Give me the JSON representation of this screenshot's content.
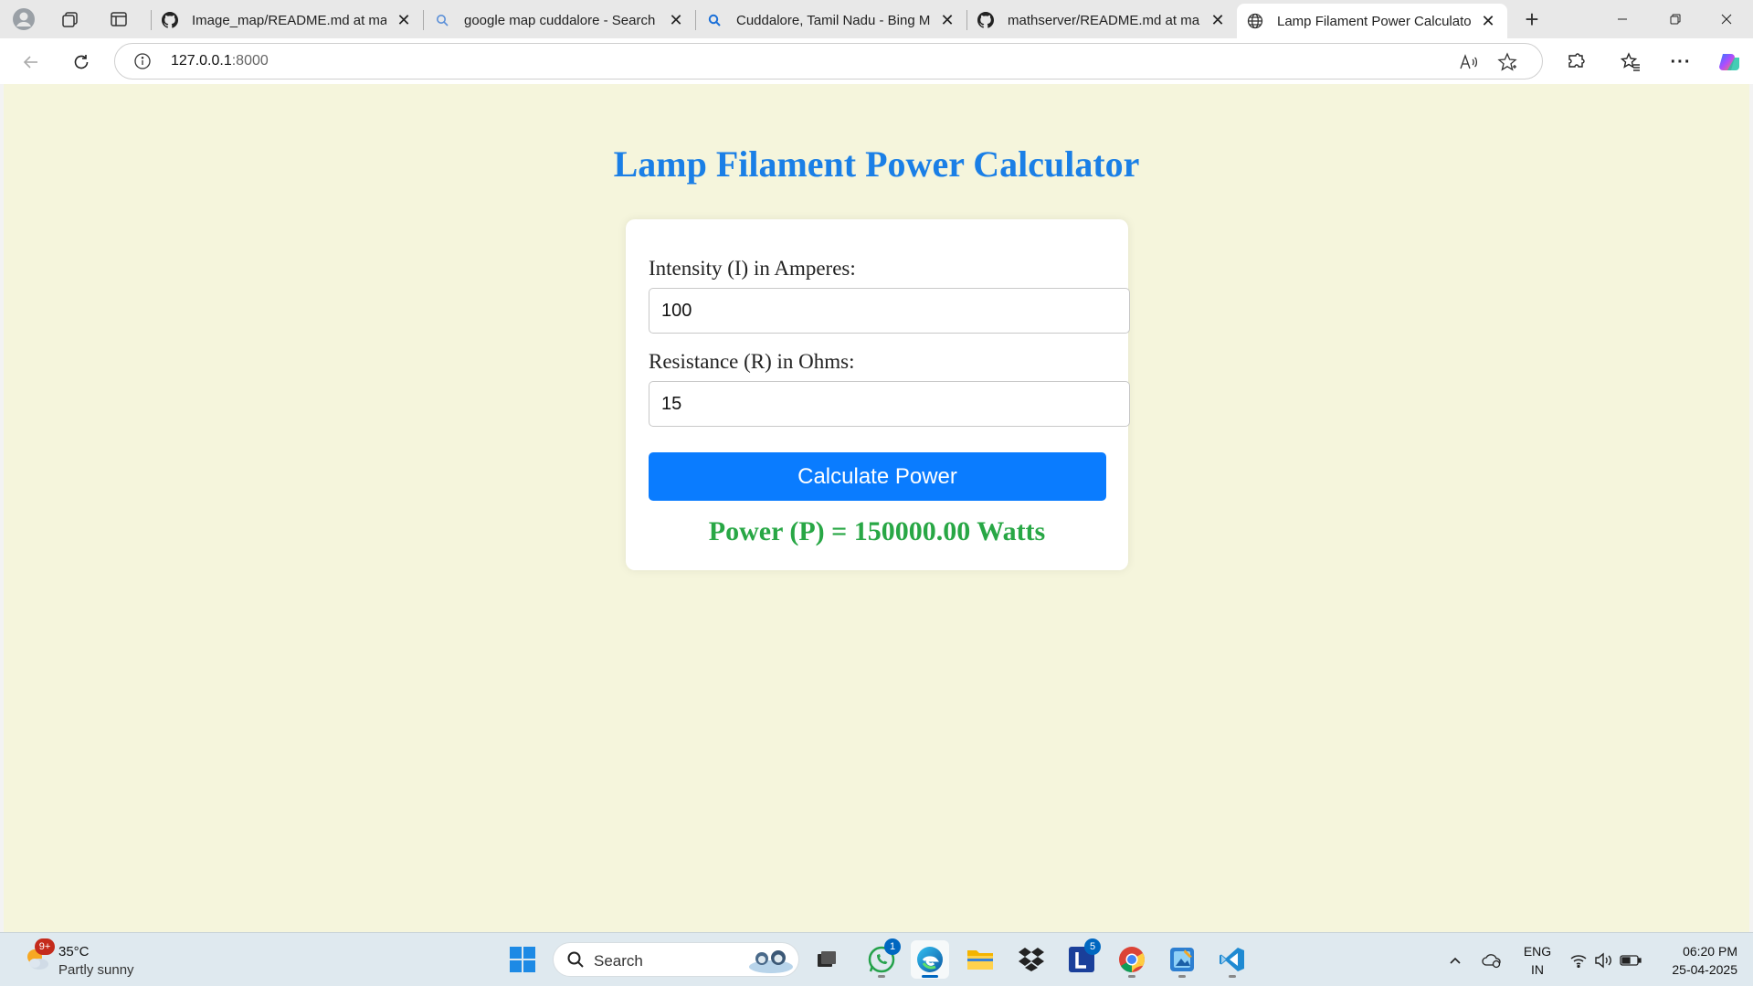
{
  "browser": {
    "tabs": [
      {
        "title": "Image_map/README.md at main",
        "icon": "github-icon"
      },
      {
        "title": "google map cuddalore - Search",
        "icon": "search-icon"
      },
      {
        "title": "Cuddalore, Tamil Nadu - Bing Ma",
        "icon": "search-icon"
      },
      {
        "title": "mathserver/README.md at main",
        "icon": "github-icon"
      },
      {
        "title": "Lamp Filament Power Calculator",
        "icon": "globe-icon",
        "active": true
      }
    ],
    "address": {
      "host": "127.0.0.1",
      "port": ":8000"
    }
  },
  "page": {
    "title": "Lamp Filament Power Calculator",
    "intensity_label": "Intensity (I) in Amperes:",
    "intensity_value": "100",
    "resistance_label": "Resistance (R) in Ohms:",
    "resistance_value": "15",
    "button_label": "Calculate Power",
    "result": "Power (P) = 150000.00 Watts"
  },
  "taskbar": {
    "weather": {
      "badge": "9+",
      "temp": "35°C",
      "desc": "Partly sunny"
    },
    "search_label": "Search",
    "apps": [
      {
        "name": "windows-start",
        "badge": ""
      },
      {
        "name": "task-view",
        "badge": ""
      },
      {
        "name": "whatsapp",
        "badge": "1"
      },
      {
        "name": "edge",
        "badge": "",
        "active": true
      },
      {
        "name": "file-explorer",
        "badge": ""
      },
      {
        "name": "dropbox",
        "badge": ""
      },
      {
        "name": "lens",
        "badge": "5"
      },
      {
        "name": "chrome",
        "badge": ""
      },
      {
        "name": "paint",
        "badge": ""
      },
      {
        "name": "vscode",
        "badge": ""
      }
    ],
    "lang_top": "ENG",
    "lang_bottom": "IN",
    "time": "06:20 PM",
    "date": "25-04-2025"
  },
  "colors": {
    "page_bg": "#f5f5dc",
    "title": "#1a7fe6",
    "button": "#0a7cff",
    "result": "#28a745"
  }
}
